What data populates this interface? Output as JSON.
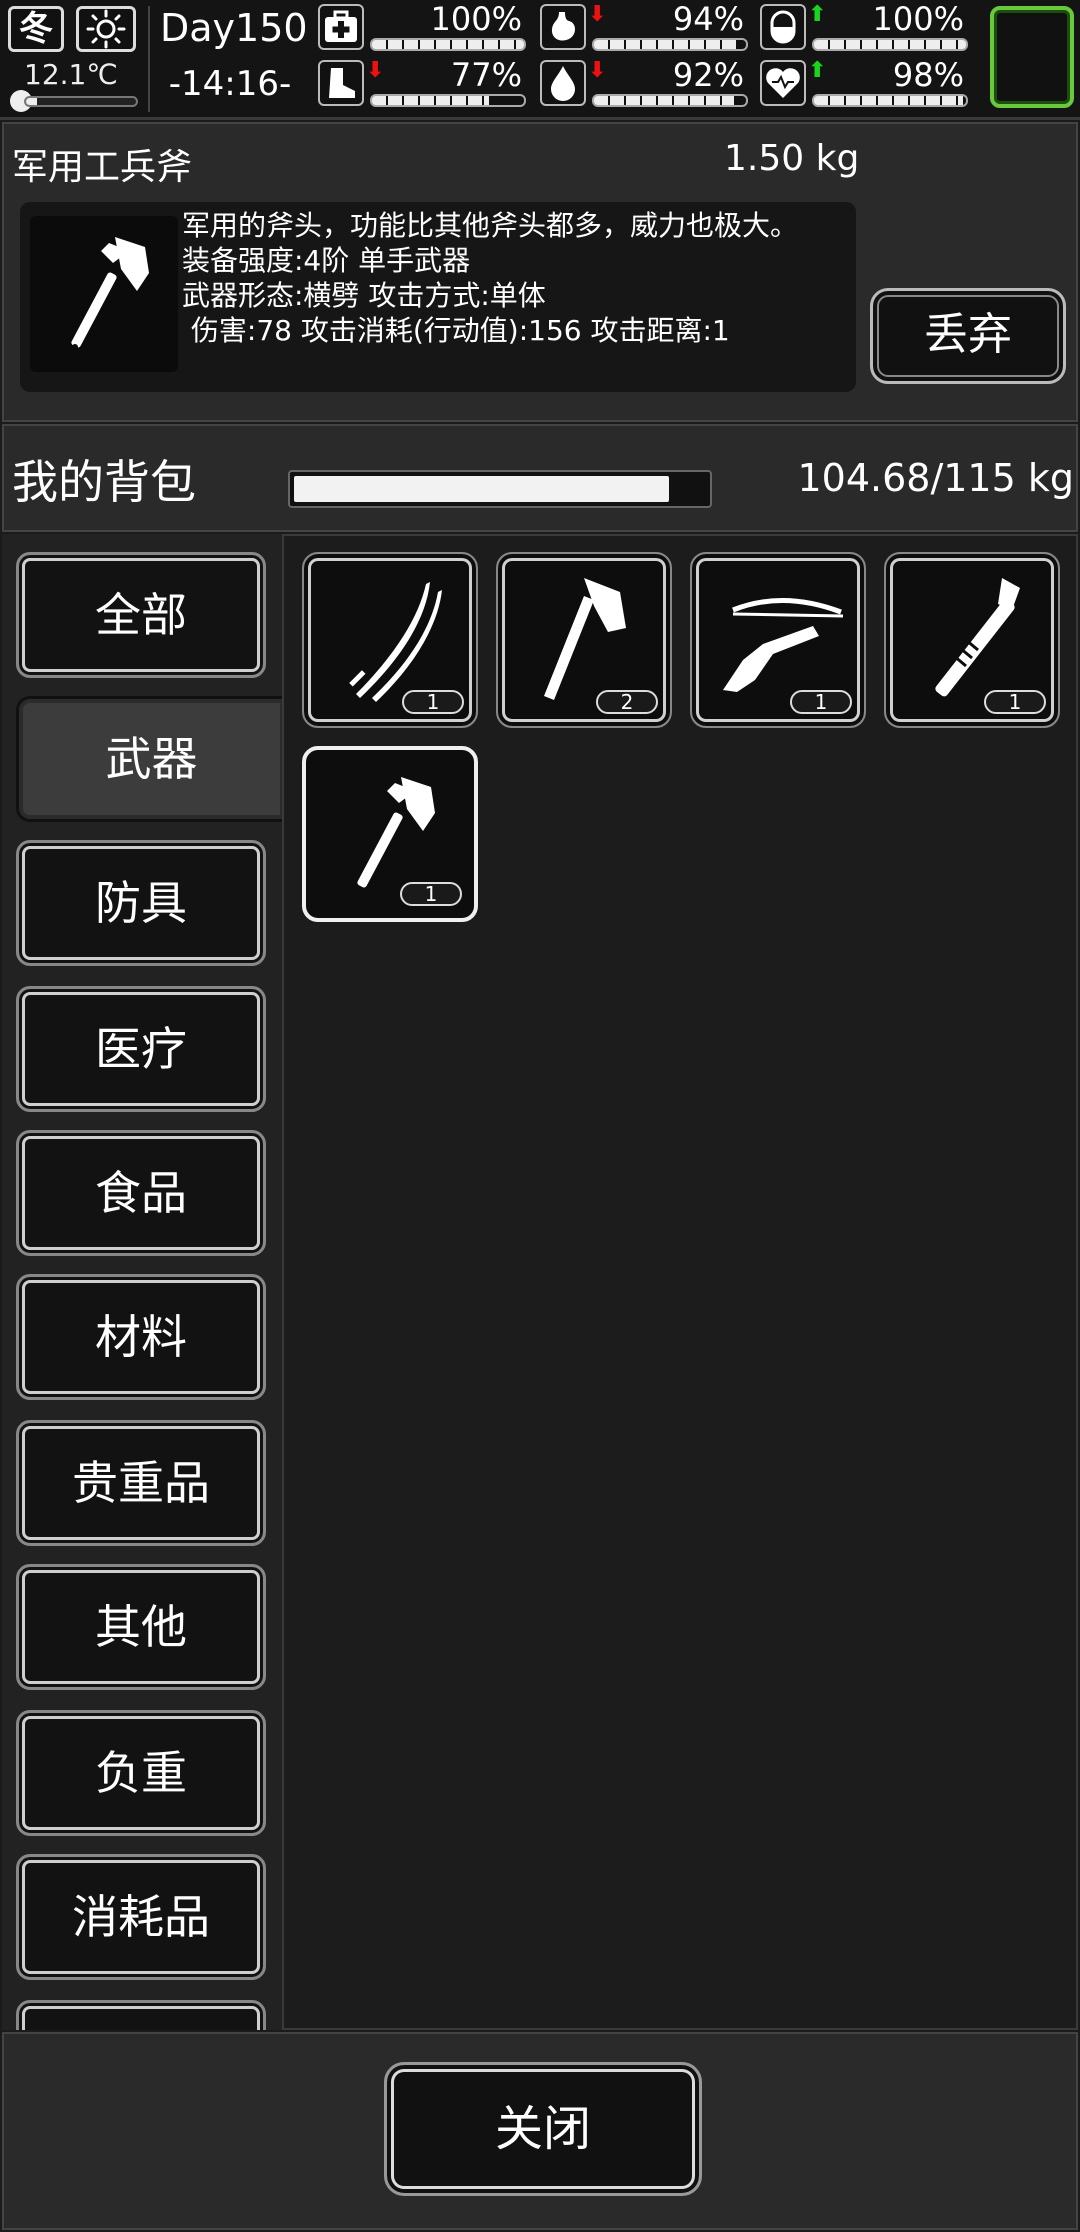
{
  "status": {
    "season": "冬",
    "weather_icon": "sun-icon",
    "temperature": "12.1℃",
    "temperature_level": 0.1,
    "day": "Day150",
    "time": "-14:16-",
    "stats": [
      {
        "name": "health",
        "icon": "first-aid-icon",
        "value": "100%",
        "level": 1.0,
        "trend": ""
      },
      {
        "name": "hunger",
        "icon": "stomach-icon",
        "value": "94%",
        "level": 0.94,
        "trend": "down"
      },
      {
        "name": "medicine",
        "icon": "pill-icon",
        "value": "100%",
        "level": 1.0,
        "trend": "up"
      },
      {
        "name": "stamina",
        "icon": "foot-icon",
        "value": "77%",
        "level": 0.77,
        "trend": "down"
      },
      {
        "name": "thirst",
        "icon": "water-drop-icon",
        "value": "92%",
        "level": 0.92,
        "trend": "down"
      },
      {
        "name": "mood",
        "icon": "heart-icon",
        "value": "98%",
        "level": 0.98,
        "trend": "up"
      }
    ],
    "accent_green": "#69c93b"
  },
  "detail": {
    "item_name": "军用工兵斧",
    "item_weight": "1.50 kg",
    "description": "军用的斧头，功能比其他斧头都多，威力也极大。",
    "line_tier": "装备强度:4阶 单手武器",
    "line_form": "武器形态:横劈 攻击方式:单体",
    "line_stats": " 伤害:78 攻击消耗(行动值):156 攻击距离:1",
    "discard_label": "丢弃"
  },
  "backpack": {
    "title": "我的背包",
    "weight_text": "104.68/115 kg",
    "fill_level": 0.9103
  },
  "categories": [
    {
      "label": "全部",
      "active": false
    },
    {
      "label": "武器",
      "active": true
    },
    {
      "label": "防具",
      "active": false
    },
    {
      "label": "医疗",
      "active": false
    },
    {
      "label": "食品",
      "active": false
    },
    {
      "label": "材料",
      "active": false
    },
    {
      "label": "贵重品",
      "active": false
    },
    {
      "label": "其他",
      "active": false
    },
    {
      "label": "负重",
      "active": false
    },
    {
      "label": "消耗品",
      "active": false
    }
  ],
  "items": [
    {
      "icon": "katana-icon",
      "count": "1"
    },
    {
      "icon": "axe-icon",
      "count": "2"
    },
    {
      "icon": "crossbow-icon",
      "count": "1"
    },
    {
      "icon": "pipe-wrench-icon",
      "count": "1"
    },
    {
      "icon": "military-axe-icon",
      "count": "1",
      "selected": true
    }
  ],
  "close_label": "关闭"
}
